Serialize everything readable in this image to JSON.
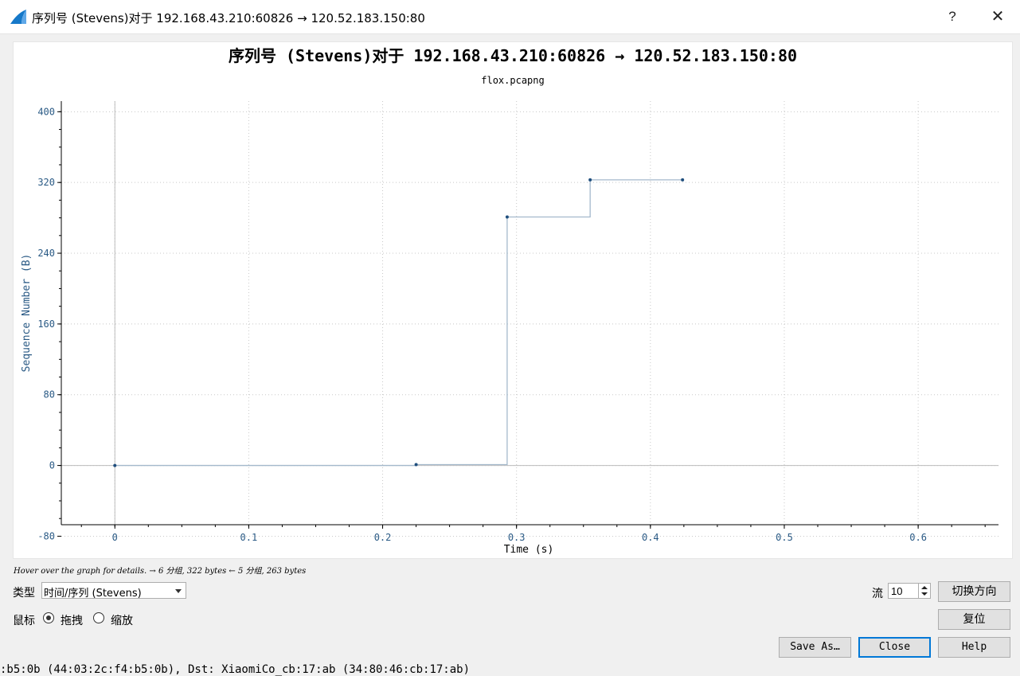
{
  "window": {
    "title": "序列号 (Stevens)对于 192.168.43.210:60826 → 120.52.183.150:80",
    "help_label": "?",
    "close_label": "✕"
  },
  "chart_data": {
    "type": "line",
    "title": "序列号 (Stevens)对于 192.168.43.210:60826 → 120.52.183.150:80",
    "subtitle": "flox.pcapng",
    "xlabel": "Time (s)",
    "ylabel": "Sequence Number (B)",
    "xlim": [
      -0.04,
      0.66
    ],
    "ylim": [
      -67,
      412
    ],
    "xticks": [
      0,
      0.1,
      0.2,
      0.3,
      0.4,
      0.5,
      0.6
    ],
    "xtick_labels": [
      "0",
      "0.1",
      "0.2",
      "0.3",
      "0.4",
      "0.5",
      "0.6"
    ],
    "yticks": [
      -80,
      0,
      80,
      160,
      240,
      320,
      400
    ],
    "ytick_labels": [
      "-80",
      "0",
      "80",
      "160",
      "240",
      "320",
      "400"
    ],
    "grid": true,
    "line_color": "#a4b9cc",
    "point_color": "#1f4e7d",
    "series": [
      {
        "step": true,
        "x": [
          0,
          0.225,
          0.293,
          0.355,
          0.424
        ],
        "y": [
          0,
          1,
          281,
          323,
          323
        ]
      }
    ]
  },
  "status": {
    "hover_text": "Hover over the graph for details. → 6 分组, 322 bytes ← 5 分组, 263 bytes"
  },
  "controls": {
    "type_label": "类型",
    "type_value": "时间/序列 (Stevens)",
    "mouse_label": "鼠标",
    "drag_label": "拖拽",
    "zoom_label": "缩放",
    "stream_label": "流",
    "stream_value": "10",
    "switch_direction": "切换方向",
    "reset": "复位",
    "save_as": "Save As…",
    "close": "Close",
    "help": "Help"
  },
  "background": {
    "packet_text": ":b5:0b (44:03:2c:f4:b5:0b), Dst: XiaomiCo_cb:17:ab (34:80:46:cb:17:ab)"
  }
}
